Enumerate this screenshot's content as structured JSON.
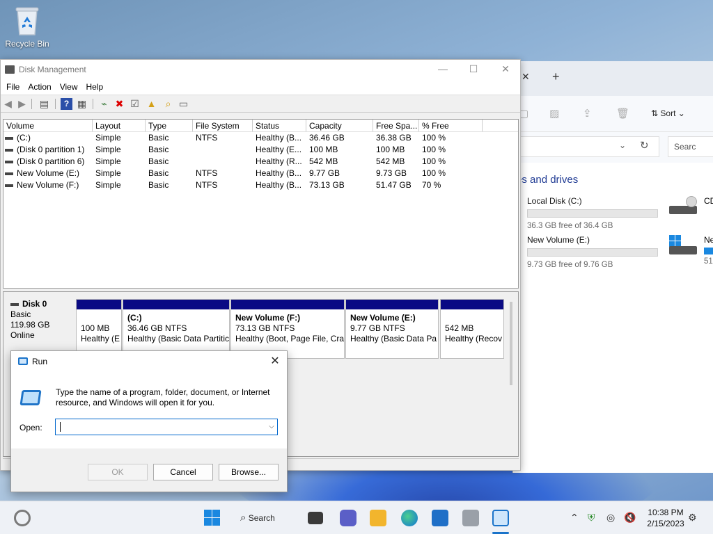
{
  "desktop": {
    "recycle_bin_label": "Recycle Bin"
  },
  "explorer": {
    "sort_label": "Sort",
    "search_placeholder": "Searc",
    "section_title": "es and drives",
    "drives": [
      {
        "name": "Local Disk (C:)",
        "free": "36.3 GB free of 36.4 GB",
        "used_fraction": 0.003
      },
      {
        "name": "New Volume (E:)",
        "free": "9.73 GB free of 9.76 GB",
        "used_fraction": 0.003
      }
    ],
    "right_partial": [
      {
        "name": "CD"
      },
      {
        "name": "Ne",
        "free": "51"
      }
    ]
  },
  "disk_mgmt": {
    "title": "Disk Management",
    "menu": [
      "File",
      "Action",
      "View",
      "Help"
    ],
    "columns": [
      "Volume",
      "Layout",
      "Type",
      "File System",
      "Status",
      "Capacity",
      "Free Spa...",
      "% Free"
    ],
    "rows": [
      [
        "(C:)",
        "Simple",
        "Basic",
        "NTFS",
        "Healthy (B...",
        "36.46 GB",
        "36.38 GB",
        "100 %"
      ],
      [
        "(Disk 0 partition 1)",
        "Simple",
        "Basic",
        "",
        "Healthy (E...",
        "100 MB",
        "100 MB",
        "100 %"
      ],
      [
        "(Disk 0 partition 6)",
        "Simple",
        "Basic",
        "",
        "Healthy (R...",
        "542 MB",
        "542 MB",
        "100 %"
      ],
      [
        "New Volume (E:)",
        "Simple",
        "Basic",
        "NTFS",
        "Healthy (B...",
        "9.77 GB",
        "9.73 GB",
        "100 %"
      ],
      [
        "New Volume (F:)",
        "Simple",
        "Basic",
        "NTFS",
        "Healthy (B...",
        "73.13 GB",
        "51.47 GB",
        "70 %"
      ]
    ],
    "disk": {
      "name": "Disk 0",
      "type": "Basic",
      "size": "119.98 GB",
      "state": "Online"
    },
    "partitions": [
      {
        "name": "",
        "size": "100 MB",
        "status": "Healthy (E"
      },
      {
        "name": "(C:)",
        "size": "36.46 GB NTFS",
        "status": "Healthy (Basic Data Partitic"
      },
      {
        "name": "New Volume  (F:)",
        "size": "73.13 GB NTFS",
        "status": "Healthy (Boot, Page File, Cra"
      },
      {
        "name": "New Volume  (E:)",
        "size": "9.77 GB NTFS",
        "status": "Healthy (Basic Data Pa"
      },
      {
        "name": "",
        "size": "542 MB",
        "status": "Healthy (Recov"
      }
    ]
  },
  "run_dialog": {
    "title": "Run",
    "description": "Type the name of a program, folder, document, or Internet resource, and Windows will open it for you.",
    "open_label": "Open:",
    "open_value": "",
    "ok": "OK",
    "cancel": "Cancel",
    "browse": "Browse..."
  },
  "taskbar": {
    "search_label": "Search",
    "time": "10:38 PM",
    "date": "2/15/2023"
  }
}
